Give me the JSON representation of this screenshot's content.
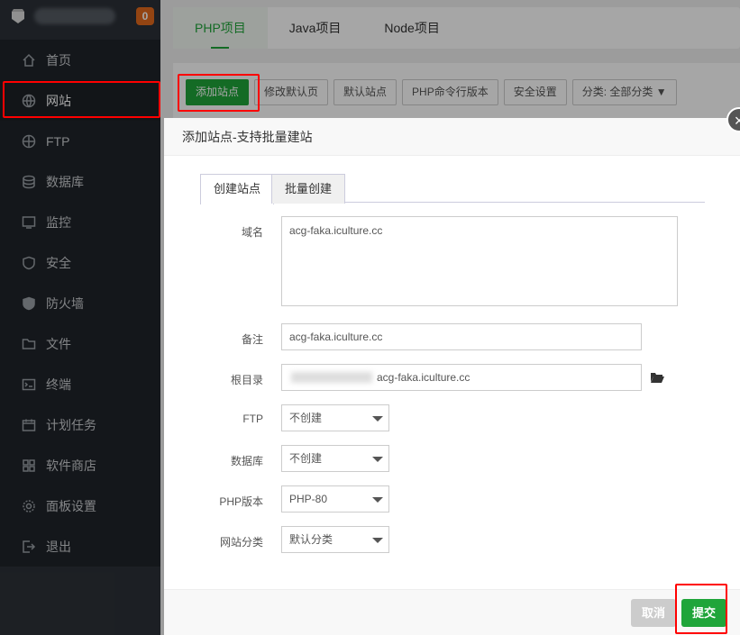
{
  "sidebar": {
    "badge": "0",
    "items": [
      {
        "label": "首页",
        "icon": "home-icon"
      },
      {
        "label": "网站",
        "icon": "globe-icon"
      },
      {
        "label": "FTP",
        "icon": "ftp-icon"
      },
      {
        "label": "数据库",
        "icon": "database-icon"
      },
      {
        "label": "监控",
        "icon": "monitor-icon"
      },
      {
        "label": "安全",
        "icon": "shield-icon"
      },
      {
        "label": "防火墙",
        "icon": "firewall-icon"
      },
      {
        "label": "文件",
        "icon": "folder-icon"
      },
      {
        "label": "终端",
        "icon": "terminal-icon"
      },
      {
        "label": "计划任务",
        "icon": "calendar-icon"
      },
      {
        "label": "软件商店",
        "icon": "apps-icon"
      },
      {
        "label": "面板设置",
        "icon": "gear-icon"
      },
      {
        "label": "退出",
        "icon": "logout-icon"
      }
    ]
  },
  "tabs": [
    "PHP项目",
    "Java项目",
    "Node项目"
  ],
  "toolbar": [
    "添加站点",
    "修改默认页",
    "默认站点",
    "PHP命令行版本",
    "安全设置",
    "分类: 全部分类"
  ],
  "dialog": {
    "title": "添加站点-支持批量建站",
    "tabs": [
      "创建站点",
      "批量创建"
    ],
    "fields": {
      "domain_label": "域名",
      "domain": "acg-faka.iculture.cc",
      "remark_label": "备注",
      "remark": "acg-faka.iculture.cc",
      "root_label": "根目录",
      "root": "acg-faka.iculture.cc",
      "ftp_label": "FTP",
      "ftp": "不创建",
      "db_label": "数据库",
      "db": "不创建",
      "php_label": "PHP版本",
      "php": "PHP-80",
      "cat_label": "网站分类",
      "cat": "默认分类"
    },
    "cancel": "取消",
    "submit": "提交"
  }
}
